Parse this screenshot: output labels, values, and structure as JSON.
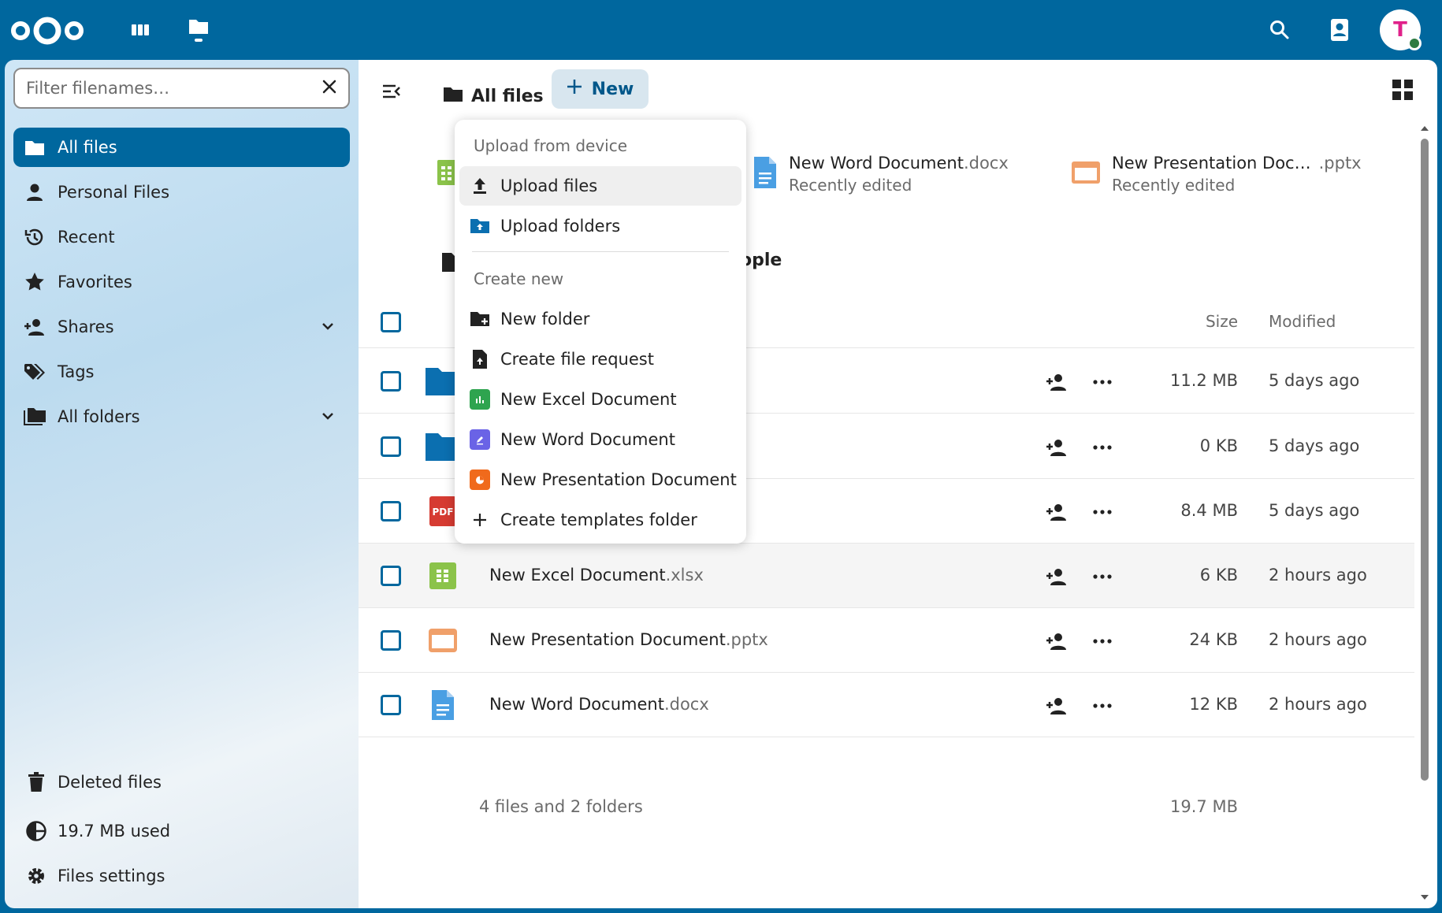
{
  "topbar": {
    "avatar_initial": "T"
  },
  "sidebar": {
    "filter_placeholder": "Filter filenames…",
    "items": [
      {
        "label": "All files"
      },
      {
        "label": "Personal Files"
      },
      {
        "label": "Recent"
      },
      {
        "label": "Favorites"
      },
      {
        "label": "Shares"
      },
      {
        "label": "Tags"
      },
      {
        "label": "All folders"
      }
    ],
    "bottom": {
      "deleted": "Deleted files",
      "quota": "19.7 MB used",
      "settings": "Files settings"
    }
  },
  "toolbar": {
    "breadcrumb": "All files",
    "new_label": "New"
  },
  "recent": [
    {
      "name": "New Word Document",
      "ext": ".docx",
      "sub": "Recently edited"
    },
    {
      "name": "New Presentation Doc…",
      "ext": ".pptx",
      "sub": "Recently edited"
    }
  ],
  "section_fragment": "ople",
  "list": {
    "header_size": "Size",
    "header_modified": "Modified",
    "rows": [
      {
        "name": "",
        "ext": "",
        "size": "11.2 MB",
        "modified": "5 days ago"
      },
      {
        "name": "",
        "ext": "",
        "size": "0 KB",
        "modified": "5 days ago"
      },
      {
        "name": "",
        "ext": "",
        "size": "8.4 MB",
        "modified": "5 days ago"
      },
      {
        "name": "New Excel Document",
        "ext": ".xlsx",
        "size": "6 KB",
        "modified": "2 hours ago"
      },
      {
        "name": "New Presentation Document",
        "ext": ".pptx",
        "size": "24 KB",
        "modified": "2 hours ago"
      },
      {
        "name": "New Word Document",
        "ext": ".docx",
        "size": "12 KB",
        "modified": "2 hours ago"
      }
    ],
    "summary_text": "4 files and 2 folders",
    "summary_size": "19.7 MB"
  },
  "menu": {
    "caption_upload": "Upload from device",
    "upload_files": "Upload files",
    "upload_folders": "Upload folders",
    "caption_create": "Create new",
    "new_folder": "New folder",
    "file_request": "Create file request",
    "new_excel": "New Excel Document",
    "new_word": "New Word Document",
    "new_presentation": "New Presentation Document",
    "templates_folder": "Create templates folder"
  },
  "colors": {
    "brand": "#00679e",
    "excel": "#2ea44f",
    "word": "#6a63e6",
    "presentation": "#f06a1c"
  }
}
